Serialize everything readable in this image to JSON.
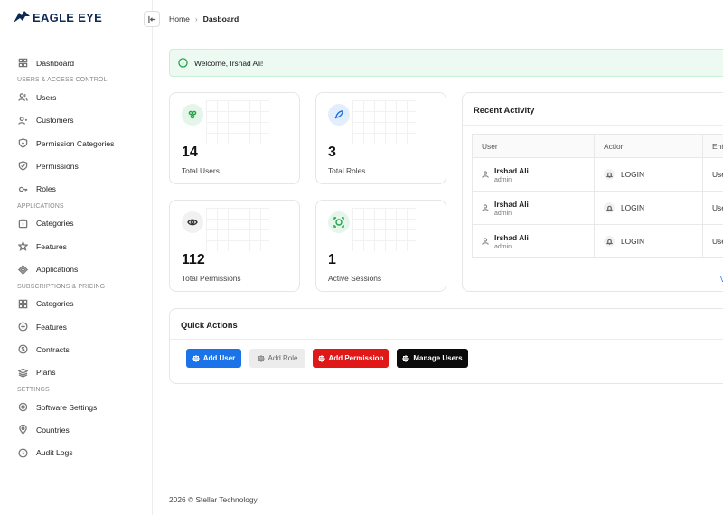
{
  "brand": {
    "name": "EAGLE EYE"
  },
  "header": {
    "breadcrumb": [
      "Home",
      "Dasboard"
    ]
  },
  "sidebar": {
    "items": [
      {
        "type": "item",
        "label": "Dashboard",
        "icon": "grid-icon"
      },
      {
        "type": "section",
        "label": "USERS & ACCESS CONTROL"
      },
      {
        "type": "item",
        "label": "Users",
        "icon": "users-icon"
      },
      {
        "type": "item",
        "label": "Customers",
        "icon": "customers-icon"
      },
      {
        "type": "item",
        "label": "Permission Categories",
        "icon": "shield-icon"
      },
      {
        "type": "item",
        "label": "Permissions",
        "icon": "shield-check-icon"
      },
      {
        "type": "item",
        "label": "Roles",
        "icon": "key-icon"
      },
      {
        "type": "section",
        "label": "APPLICATIONS"
      },
      {
        "type": "item",
        "label": "Categories",
        "icon": "folder-icon"
      },
      {
        "type": "item",
        "label": "Features",
        "icon": "star-icon"
      },
      {
        "type": "item",
        "label": "Applications",
        "icon": "diamond-icon"
      },
      {
        "type": "section",
        "label": "SUBSCRIPTIONS & PRICING"
      },
      {
        "type": "item",
        "label": "Categories",
        "icon": "grid-icon"
      },
      {
        "type": "item",
        "label": "Features",
        "icon": "plus-circle-icon"
      },
      {
        "type": "item",
        "label": "Contracts",
        "icon": "dollar-icon"
      },
      {
        "type": "item",
        "label": "Plans",
        "icon": "layers-icon"
      },
      {
        "type": "section",
        "label": "SETTINGS"
      },
      {
        "type": "item",
        "label": "Software Settings",
        "icon": "gear-icon"
      },
      {
        "type": "item",
        "label": "Countries",
        "icon": "location-icon"
      },
      {
        "type": "item",
        "label": "Audit Logs",
        "icon": "clock-icon"
      }
    ]
  },
  "alert": {
    "text": "Welcome, Irshad Ali!"
  },
  "stats": [
    {
      "value": "14",
      "caption": "Total Users",
      "icon": "users-group-icon",
      "color": "#22a447",
      "bg": "#e3f6e9"
    },
    {
      "value": "3",
      "caption": "Total Roles",
      "icon": "rocket-icon",
      "color": "#1d74e8",
      "bg": "#e3eefc"
    },
    {
      "value": "112",
      "caption": "Total Permissions",
      "icon": "eye-icon",
      "color": "#333333",
      "bg": "#f1f1f1"
    },
    {
      "value": "1",
      "caption": "Active Sessions",
      "icon": "session-icon",
      "color": "#22a447",
      "bg": "#e3f6e9"
    }
  ],
  "activity": {
    "title": "Recent Activity",
    "columns": [
      "User",
      "Action",
      "Ent"
    ],
    "rows": [
      {
        "name": "Irshad Ali",
        "role": "admin",
        "action": "LOGIN",
        "entity": "Use"
      },
      {
        "name": "Irshad Ali",
        "role": "admin",
        "action": "LOGIN",
        "entity": "Use"
      },
      {
        "name": "Irshad Ali",
        "role": "admin",
        "action": "LOGIN",
        "entity": "Use"
      }
    ],
    "link": "V"
  },
  "quick_actions": {
    "title": "Quick Actions",
    "buttons": [
      "Add User",
      "Add Role",
      "Add Permission",
      "Manage Users"
    ]
  },
  "footer": {
    "text": "2026 ©  Stellar Technology."
  }
}
